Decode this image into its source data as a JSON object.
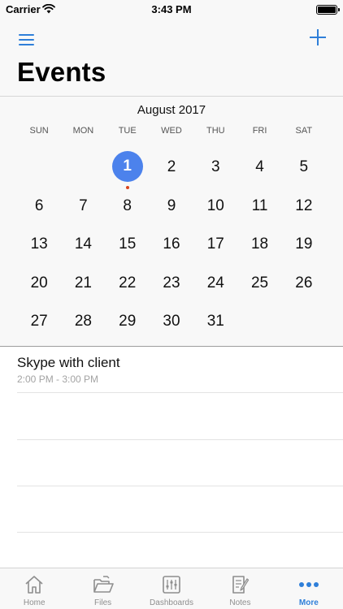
{
  "status_bar": {
    "carrier": "Carrier",
    "time": "3:43 PM"
  },
  "nav": {
    "title": "Events"
  },
  "calendar": {
    "month": "August 2017",
    "weekdays": [
      "SUN",
      "MON",
      "TUE",
      "WED",
      "THU",
      "FRI",
      "SAT"
    ],
    "weeks": [
      [
        "",
        "",
        "1",
        "2",
        "3",
        "4",
        "5"
      ],
      [
        "6",
        "7",
        "8",
        "9",
        "10",
        "11",
        "12"
      ],
      [
        "13",
        "14",
        "15",
        "16",
        "17",
        "18",
        "19"
      ],
      [
        "20",
        "21",
        "22",
        "23",
        "24",
        "25",
        "26"
      ],
      [
        "27",
        "28",
        "29",
        "30",
        "31",
        "",
        ""
      ]
    ],
    "today": "1",
    "event_days": [
      "1"
    ]
  },
  "events": [
    {
      "title": "Skype with client",
      "time": "2:00 PM - 3:00 PM"
    }
  ],
  "tabs": [
    {
      "label": "Home",
      "icon": "home-icon"
    },
    {
      "label": "Files",
      "icon": "folder-icon"
    },
    {
      "label": "Dashboards",
      "icon": "dashboards-icon"
    },
    {
      "label": "Notes",
      "icon": "notes-icon"
    },
    {
      "label": "More",
      "icon": "more-icon"
    }
  ],
  "active_tab": "More",
  "colors": {
    "accent": "#2f7fd9",
    "today": "#4c82ec",
    "event_dot": "#d9441e"
  }
}
